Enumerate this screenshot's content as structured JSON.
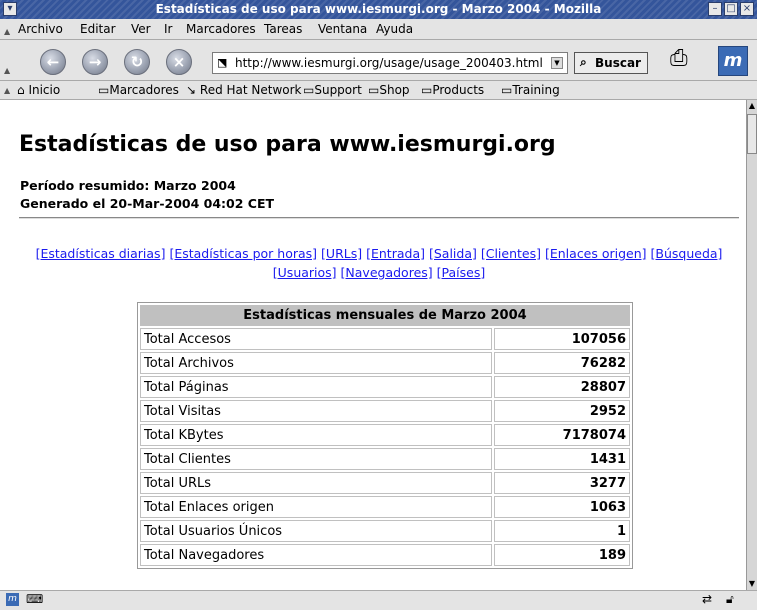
{
  "window": {
    "title": "Estadísticas de uso para www.iesmurgi.org - Marzo 2004 - Mozilla"
  },
  "menubar": {
    "items": [
      "Archivo",
      "Editar",
      "Ver",
      "Ir",
      "Marcadores",
      "Tareas",
      "Ventana",
      "Ayuda"
    ]
  },
  "navbar": {
    "url": "http://www.iesmurgi.org/usage/usage_200403.html",
    "search_label": "Buscar",
    "throbber_label": "m"
  },
  "bookmarks": {
    "items": [
      "Inicio",
      "Marcadores",
      "Red Hat Network",
      "Support",
      "Shop",
      "Products",
      "Training"
    ]
  },
  "page": {
    "title": "Estadísticas de uso para www.iesmurgi.org",
    "period": "Período resumido: Marzo 2004",
    "generated": "Generado el 20-Mar-2004 04:02 CET",
    "links": [
      "[Estadísticas diarias]",
      "[Estadísticas por horas]",
      "[URLs]",
      "[Entrada]",
      "[Salida]",
      "[Clientes]",
      "[Enlaces origen]",
      "[Búsqueda]",
      "[Usuarios]",
      "[Navegadores]",
      "[Países]"
    ]
  },
  "table": {
    "header": "Estadísticas mensuales de Marzo 2004",
    "group1": [
      {
        "label": "Total Accesos",
        "value": "107056"
      },
      {
        "label": "Total Archivos",
        "value": "76282"
      },
      {
        "label": "Total Páginas",
        "value": "28807"
      },
      {
        "label": "Total Visitas",
        "value": "2952"
      },
      {
        "label": "Total KBytes",
        "value": "7178074"
      }
    ],
    "group2": [
      {
        "label": "Total Clientes",
        "value": "1431"
      },
      {
        "label": "Total URLs",
        "value": "3277"
      },
      {
        "label": "Total Enlaces origen",
        "value": "1063"
      },
      {
        "label": "Total Usuarios Únicos",
        "value": "1"
      },
      {
        "label": "Total Navegadores",
        "value": "189"
      }
    ]
  }
}
